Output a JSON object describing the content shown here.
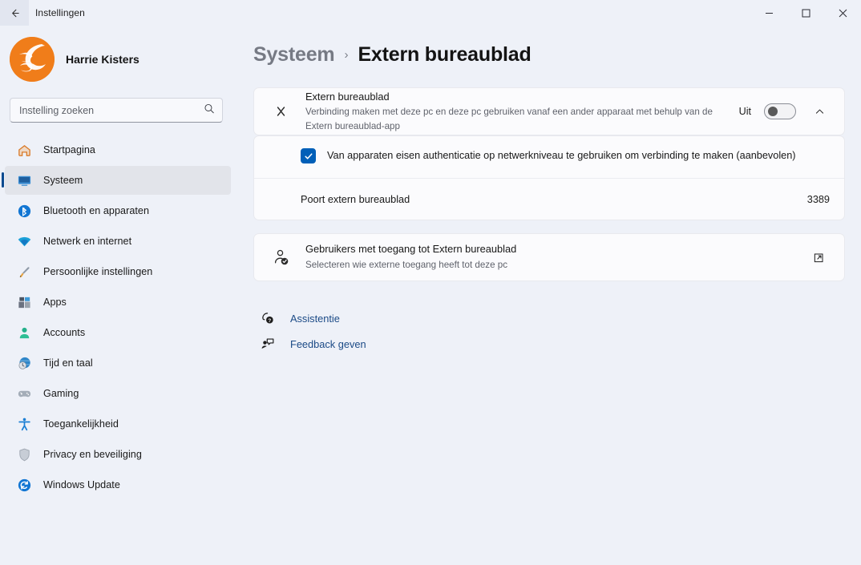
{
  "window": {
    "title": "Instellingen",
    "back_icon": "arrow-left-icon",
    "controls": {
      "minimize": "minimize-icon",
      "maximize": "maximize-icon",
      "close": "close-icon"
    }
  },
  "colors": {
    "app_background": "#eef1f8",
    "card_background": "#fbfbfd",
    "accent": "#005fb8",
    "selection_indicator": "#0b4a8f",
    "link": "#1b4a86",
    "avatar_orange": "#f07d1a"
  },
  "sidebar": {
    "account": {
      "name": "Harrie Kisters",
      "avatar_icon": "avatar"
    },
    "search": {
      "placeholder": "Instelling zoeken",
      "value": "",
      "icon": "search-icon"
    },
    "items": [
      {
        "label": "Startpagina",
        "icon": "home-icon",
        "selected": false
      },
      {
        "label": "Systeem",
        "icon": "monitor-icon",
        "selected": true
      },
      {
        "label": "Bluetooth en apparaten",
        "icon": "bluetooth-icon",
        "selected": false
      },
      {
        "label": "Netwerk en internet",
        "icon": "wifi-icon",
        "selected": false
      },
      {
        "label": "Persoonlijke instellingen",
        "icon": "brush-icon",
        "selected": false
      },
      {
        "label": "Apps",
        "icon": "apps-icon",
        "selected": false
      },
      {
        "label": "Accounts",
        "icon": "person-icon",
        "selected": false
      },
      {
        "label": "Tijd en taal",
        "icon": "clock-globe-icon",
        "selected": false
      },
      {
        "label": "Gaming",
        "icon": "gamepad-icon",
        "selected": false
      },
      {
        "label": "Toegankelijkheid",
        "icon": "accessibility-icon",
        "selected": false
      },
      {
        "label": "Privacy en beveiliging",
        "icon": "shield-icon",
        "selected": false
      },
      {
        "label": "Windows Update",
        "icon": "update-icon",
        "selected": false
      }
    ]
  },
  "breadcrumb": {
    "parent": "Systeem",
    "separator": "›",
    "current": "Extern bureaublad"
  },
  "main": {
    "remote_desktop": {
      "icon": "remote-desktop-icon",
      "title": "Extern bureaublad",
      "description": "Verbinding maken met deze pc en deze pc gebruiken vanaf een ander apparaat met behulp van de Extern bureaublad-app",
      "toggle_state_label": "Uit",
      "toggle_on": false,
      "expand_icon": "chevron-up-icon",
      "expanded": true
    },
    "nla": {
      "checked": true,
      "check_icon": "checkmark-icon",
      "label": "Van apparaten eisen authenticatie op netwerkniveau te gebruiken om verbinding te maken (aanbevolen)"
    },
    "port": {
      "label": "Poort extern bureaublad",
      "value": "3389"
    },
    "users": {
      "icon": "user-check-icon",
      "title": "Gebruikers met toegang tot Extern bureaublad",
      "description": "Selecteren wie externe toegang heeft tot deze pc",
      "action_icon": "external-link-icon"
    },
    "links": [
      {
        "label": "Assistentie",
        "icon": "help-icon"
      },
      {
        "label": "Feedback geven",
        "icon": "feedback-icon"
      }
    ]
  }
}
